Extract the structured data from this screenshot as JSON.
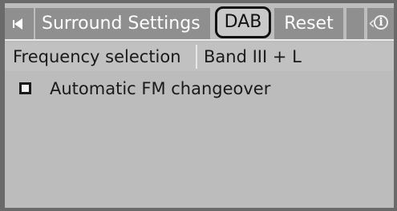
{
  "tabs": {
    "surround": "Surround Settings",
    "dab": "DAB",
    "reset": "Reset",
    "info_icon": "info-icon",
    "back_icon": "left-arrow-icon"
  },
  "frequency": {
    "label": "Frequency selection",
    "value": "Band III + L"
  },
  "options": {
    "auto_fm_label": "Automatic FM changeover",
    "auto_fm_checked": false
  },
  "colors": {
    "tab_bg": "#8f8f8f",
    "active_tab_bg": "#c9c9c9",
    "screen_bg": "#bcbcbc"
  }
}
